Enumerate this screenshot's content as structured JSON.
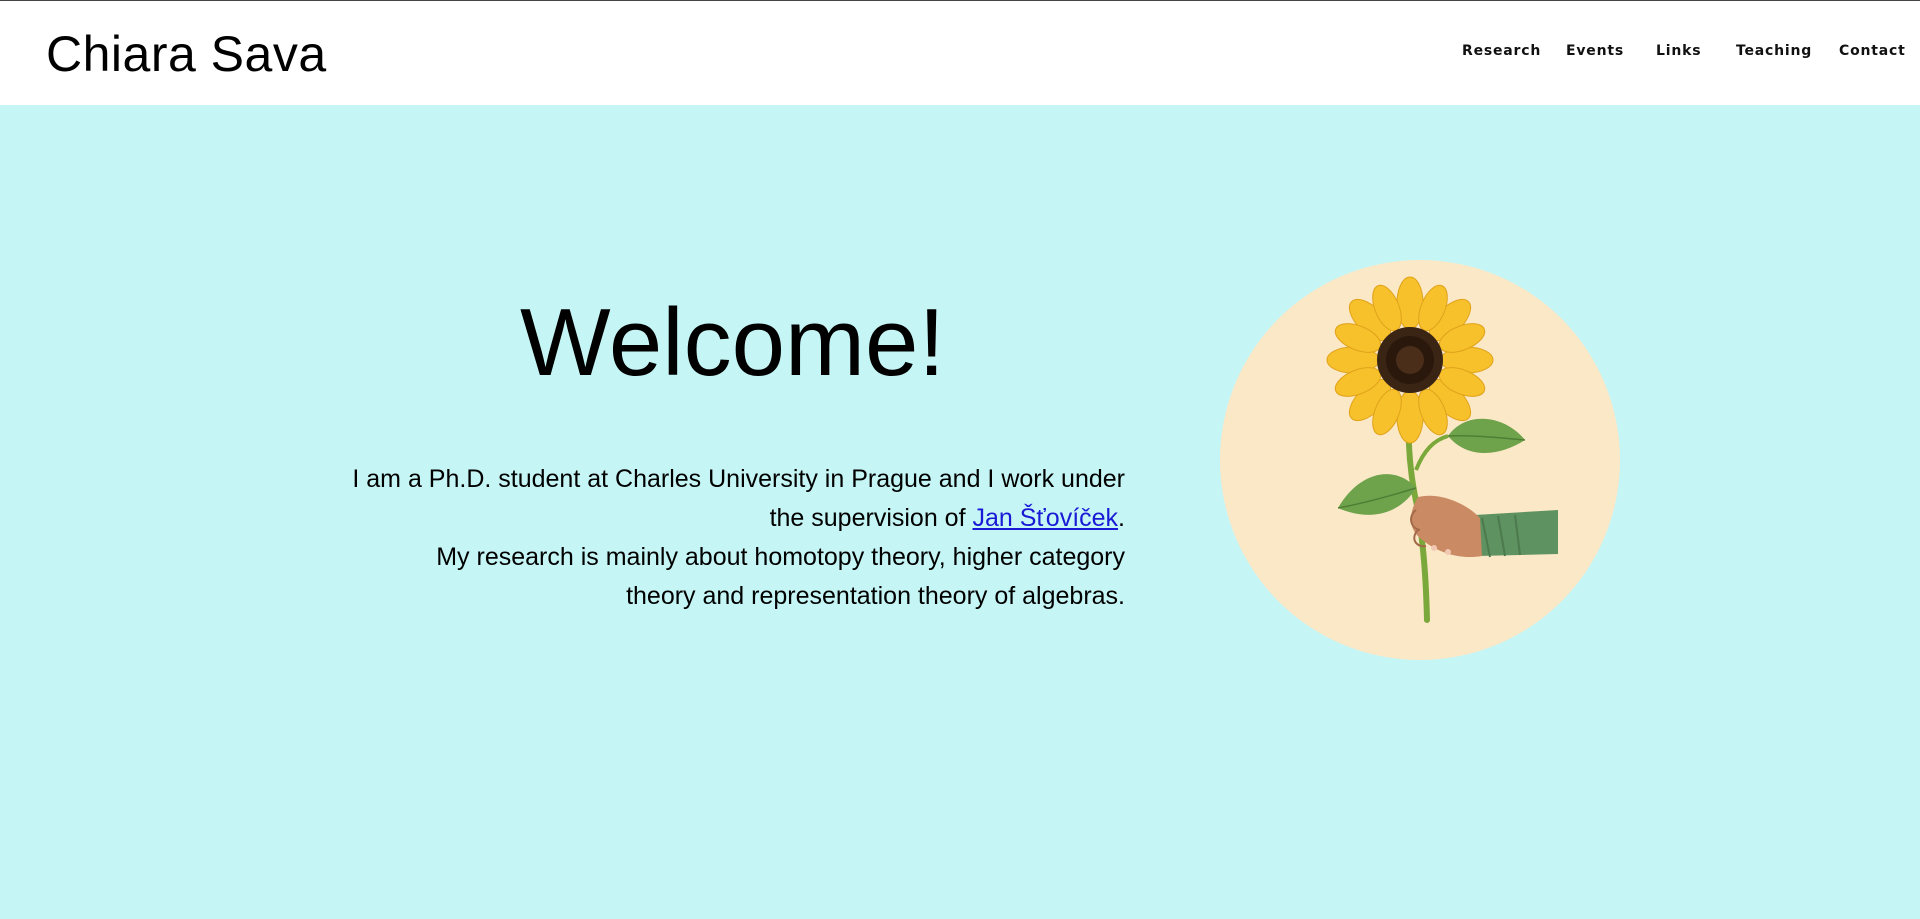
{
  "site": {
    "title": "Chiara Sava"
  },
  "nav": {
    "items": [
      {
        "label": "Research"
      },
      {
        "label": "Events"
      },
      {
        "label": "Links"
      },
      {
        "label": "Teaching"
      },
      {
        "label": "Contact"
      }
    ]
  },
  "hero": {
    "heading": "Welcome!",
    "line1": "I am a Ph.D. student at Charles University in Prague and I work under",
    "line2_pre": "the supervision of ",
    "supervisor_link": "Jan Šťovíček",
    "line2_post": ".",
    "line3": "My research is mainly about homotopy theory, higher category",
    "line4": "theory and representation theory of algebras."
  },
  "image": {
    "icon": "sunflower-in-hand-illustration"
  },
  "colors": {
    "background": "#c5f5f5",
    "header": "#ffffff",
    "circle": "#fbe8c7",
    "link": "#1a1ad6"
  }
}
